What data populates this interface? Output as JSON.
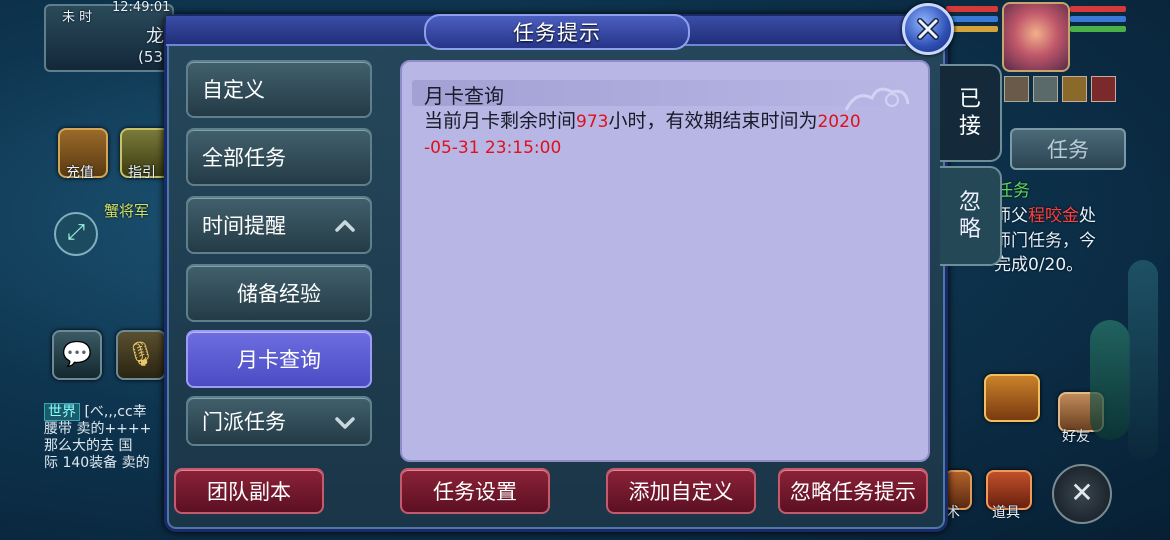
{
  "dialog": {
    "title": "任务提示",
    "menu": [
      {
        "label": "自定义"
      },
      {
        "label": "全部任务"
      },
      {
        "label": "时间提醒"
      },
      {
        "label": "储备经验"
      },
      {
        "label": "月卡查询"
      },
      {
        "label": "门派任务"
      }
    ],
    "content": {
      "title": "月卡查询",
      "line1_pre": "当前月卡剩余时间",
      "hours": "973",
      "line1_mid": "小时，有效期结束时间为",
      "date_part1": "2020",
      "date_part2": "-05-31  23:15:00"
    },
    "side_tabs": {
      "accepted": [
        "已",
        "接"
      ],
      "ignore": [
        "忽",
        "略"
      ]
    },
    "buttons": {
      "team_dungeon": "团队副本",
      "task_settings": "任务设置",
      "add_custom": "添加自定义",
      "ignore_hint": "忽略任务提示"
    }
  },
  "hud": {
    "time_label": "未 时",
    "clock": "12:49:01",
    "name_fragment": "龙",
    "level_fragment": "(53",
    "recharge": "充值",
    "guide": "指引",
    "location": "蟹将军",
    "task_button": "任务",
    "task_header": "任务",
    "task_line1_pre": "师父",
    "task_npc": "程咬金",
    "task_line1_post": "处",
    "task_line2": "师门任务，今",
    "task_line3": "完成0/20。",
    "friends": "好友",
    "items": "道具",
    "skill_fragment": "术",
    "chat_channel": "世界",
    "chat_line1": "[べ,,,cc幸",
    "chat_line2": "腰带  卖的++++",
    "chat_line3": "  那么大的去  国",
    "chat_line4": "际 140装备  卖的"
  }
}
